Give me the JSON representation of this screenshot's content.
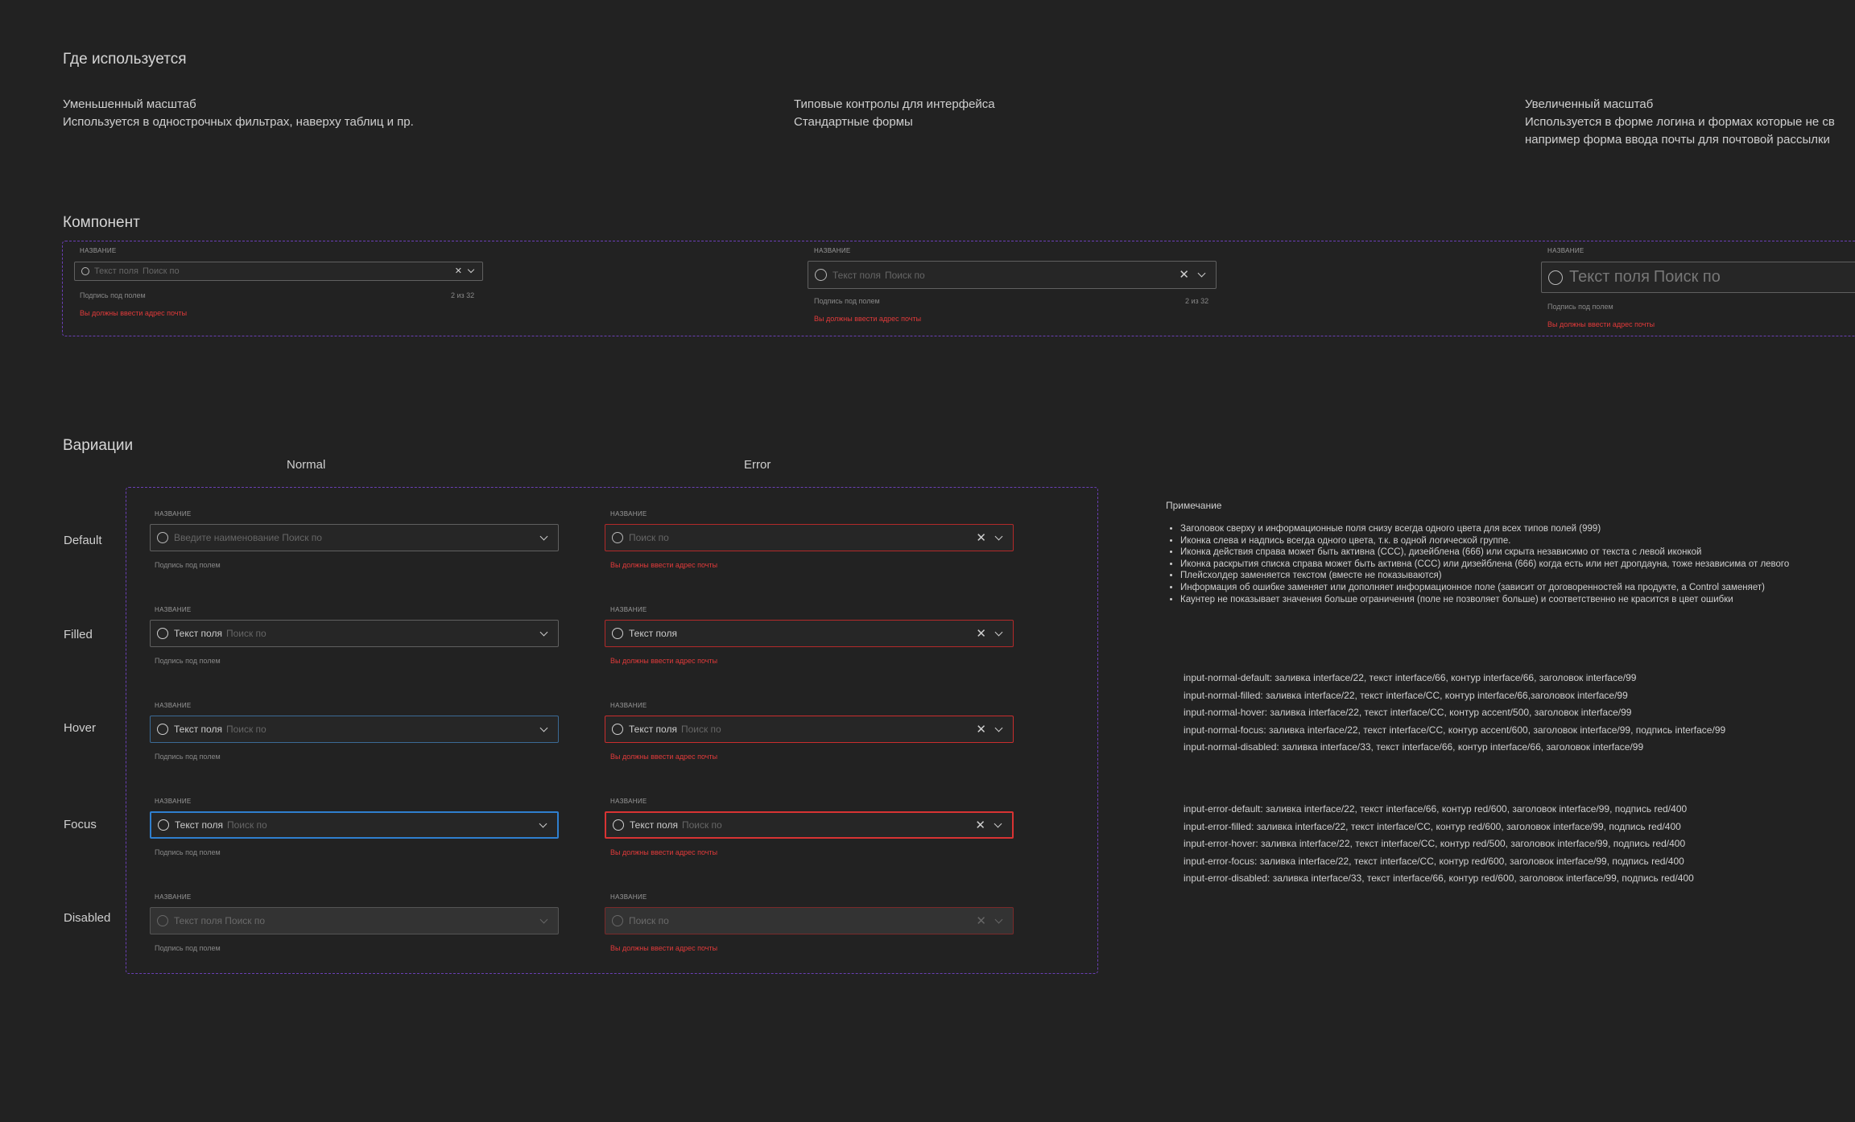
{
  "usage": {
    "title": "Где используется",
    "columns": [
      {
        "lines": [
          "Уменьшенный масштаб",
          "Используется в однострочных фильтрах, наверху таблиц и пр."
        ]
      },
      {
        "lines": [
          "Типовые контролы для интерфейса",
          "Стандартные формы"
        ]
      },
      {
        "lines": [
          "Увеличенный масштаб",
          "Используется в форме логина и формах которые не св",
          "например форма ввода почты для почтовой рассылки"
        ]
      }
    ]
  },
  "component": {
    "title": "Компонент",
    "small": {
      "label": "НАЗВАНИЕ",
      "value": "Текст поля",
      "placeholder": "Поиск по",
      "clear": "✕",
      "caption": "Подпись под полем",
      "counter": "2 из 32",
      "error": "Вы должны ввести адрес почты"
    },
    "medium": {
      "label": "НАЗВАНИЕ",
      "value": "Текст поля",
      "placeholder": "Поиск по",
      "clear": "✕",
      "caption": "Подпись под полем",
      "counter": "2 из 32",
      "error": "Вы должны ввести адрес почты"
    },
    "large": {
      "label": "НАЗВАНИЕ",
      "value": "Текст поля",
      "placeholder": "Поиск по",
      "caption": "Подпись под полем",
      "error": "Вы должны ввести адрес почты"
    }
  },
  "variations": {
    "title": "Вариации",
    "col_normal": "Normal",
    "col_error": "Error",
    "clear": "✕",
    "rows": [
      {
        "state": "Default",
        "normal": {
          "label": "НАЗВАНИЕ",
          "value": "",
          "placeholder": "Введите наименование Поиск по",
          "caption": "Подпись под полем"
        },
        "error": {
          "label": "НАЗВАНИЕ",
          "value": "",
          "placeholder": "Поиск по",
          "caption": "Вы должны ввести адрес почты"
        }
      },
      {
        "state": "Filled",
        "normal": {
          "label": "НАЗВАНИЕ",
          "value": "Текст поля",
          "placeholder": "Поиск по",
          "caption": "Подпись под полем"
        },
        "error": {
          "label": "НАЗВАНИЕ",
          "value": "Текст поля",
          "placeholder": "",
          "caption": "Вы должны ввести адрес почты"
        }
      },
      {
        "state": "Hover",
        "normal": {
          "label": "НАЗВАНИЕ",
          "value": "Текст поля",
          "placeholder": "Поиск по",
          "caption": "Подпись под полем"
        },
        "error": {
          "label": "НАЗВАНИЕ",
          "value": "Текст поля",
          "placeholder": "Поиск по",
          "caption": "Вы должны ввести адрес почты"
        }
      },
      {
        "state": "Focus",
        "normal": {
          "label": "НАЗВАНИЕ",
          "value": "Текст поля",
          "placeholder": "Поиск по",
          "caption": "Подпись под полем"
        },
        "error": {
          "label": "НАЗВАНИЕ",
          "value": "Текст поля",
          "placeholder": "Поиск по",
          "caption": "Вы должны ввести адрес почты"
        }
      },
      {
        "state": "Disabled",
        "normal": {
          "label": "НАЗВАНИЕ",
          "value": "",
          "placeholder": "Текст поля Поиск по",
          "caption": "Подпись под полем"
        },
        "error": {
          "label": "НАЗВАНИЕ",
          "value": "",
          "placeholder": "Поиск по",
          "caption": "Вы должны ввести адрес почты"
        }
      }
    ]
  },
  "notes": {
    "title": "Примечание",
    "items": [
      "Заголовок сверху и информационные поля снизу всегда одного цвета для всех типов полей (999)",
      "Иконка слева и надпись всегда одного цвета, т.к. в одной логической группе.",
      "Иконка действия справа может быть активна (CCC), дизейблена (666) или скрыта независимо от текста с левой иконкой",
      "Иконка раскрытия списка справа может быть активна (CCC) или дизейблена (666) когда есть или нет дропдауна, тоже независима от левого",
      "Плейсхолдер заменяется текстом (вместе не показываются)",
      "Информация об ошибке заменяет или дополняет информационное поле (зависит от договоренностей на продукте, а Control заменяет)",
      "Каунтер не показывает значения больше ограничения (поле не позволяет больше) и соответственно не красится в цвет ошибки"
    ]
  },
  "tokens_normal": [
    "input-normal-default: заливка interface/22, текст interface/66, контур interface/66, заголовок interface/99",
    "input-normal-filled: заливка interface/22, текст interface/CC, контур interface/66,заголовок interface/99",
    "input-normal-hover: заливка interface/22, текст interface/CC, контур accent/500, заголовок interface/99",
    "input-normal-focus: заливка interface/22, текст interface/CC, контур accent/600, заголовок interface/99, подпись interface/99",
    "input-normal-disabled: заливка interface/33, текст interface/66, контур interface/66, заголовок interface/99"
  ],
  "tokens_error": [
    "input-error-default: заливка interface/22, текст interface/66, контур red/600, заголовок interface/99, подпись red/400",
    "input-error-filled: заливка interface/22, текст interface/CC, контур red/600, заголовок interface/99, подпись red/400",
    "input-error-hover: заливка interface/22, текст interface/CC, контур red/500, заголовок interface/99, подпись red/400",
    "input-error-focus: заливка interface/22, текст interface/CC, контур red/600, заголовок interface/99, подпись red/400",
    "input-error-disabled: заливка interface/33, текст interface/66, контур red/600, заголовок interface/99, подпись red/400"
  ],
  "colors": {
    "accent": "#2f7fcf",
    "error": "#e03a3a",
    "frame": "#6a3fb5",
    "background": "#222222"
  }
}
